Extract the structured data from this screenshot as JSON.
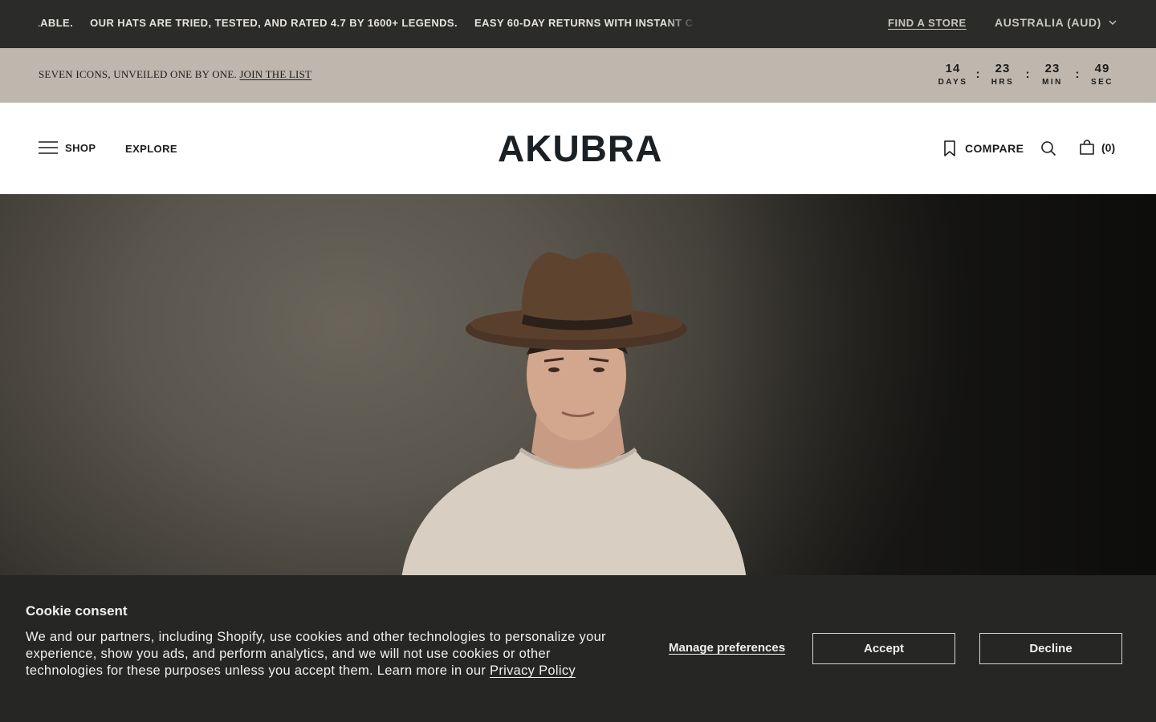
{
  "announcement": {
    "messages": [
      "AILABLE.",
      "OUR HATS ARE TRIED, TESTED, AND RATED 4.7 BY 1600+ LEGENDS.",
      "EASY 60-DAY RETURNS WITH INSTANT C"
    ],
    "find_store": "FIND A STORE",
    "country": "AUSTRALIA (AUD)"
  },
  "promo": {
    "text": "SEVEN ICONS, UNVEILED ONE BY ONE.",
    "link": "JOIN THE LIST",
    "countdown": [
      {
        "value": "14",
        "label": "DAYS"
      },
      {
        "value": "23",
        "label": "HRS"
      },
      {
        "value": "23",
        "label": "MIN"
      },
      {
        "value": "49",
        "label": "SEC"
      }
    ],
    "separator": ":"
  },
  "header": {
    "shop": "SHOP",
    "explore": "EXPLORE",
    "logo": "AKUBRA",
    "compare": "COMPARE",
    "cart_count": "(0)"
  },
  "cookie": {
    "title": "Cookie consent",
    "body": "We and our partners, including Shopify, use cookies and other technologies to personalize your experience, show you ads, and perform analytics, and we will not use cookies or other technologies for these purposes unless you accept them. Learn more in our",
    "privacy_link": "Privacy Policy",
    "manage": "Manage preferences",
    "accept": "Accept",
    "decline": "Decline"
  },
  "icons": {
    "menu": "hamburger-icon",
    "country_dropdown": "chevron-down-icon",
    "compare": "bookmark-icon",
    "search": "search-icon",
    "cart": "bag-icon"
  }
}
